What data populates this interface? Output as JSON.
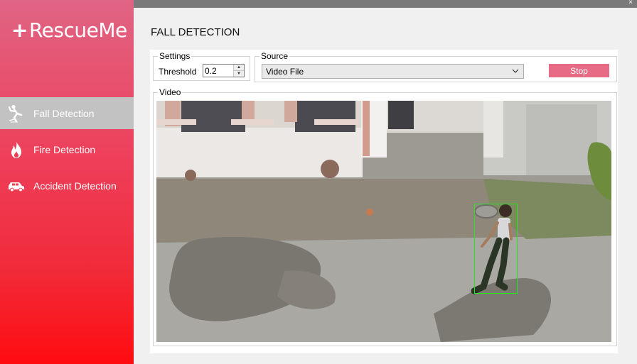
{
  "app": {
    "name": "RescueMe",
    "plus": "+"
  },
  "window": {
    "close_glyph": "×"
  },
  "nav": [
    {
      "label": "Fall Detection",
      "icon": "falling-person-icon",
      "active": true
    },
    {
      "label": "Fire Detection",
      "icon": "flame-icon",
      "active": false
    },
    {
      "label": "Accident Detection",
      "icon": "car-crash-icon",
      "active": false
    }
  ],
  "page": {
    "title": "FALL DETECTION"
  },
  "settings": {
    "legend": "Settings",
    "threshold_label": "Threshold",
    "threshold_value": "0.2"
  },
  "source": {
    "legend": "Source",
    "selected": "Video File",
    "stop_label": "Stop"
  },
  "video": {
    "legend": "Video"
  },
  "colors": {
    "accent": "#e86b86",
    "sidebar_top": "#e06484",
    "sidebar_bottom": "#ff0c10",
    "detection_box": "#22e622"
  }
}
